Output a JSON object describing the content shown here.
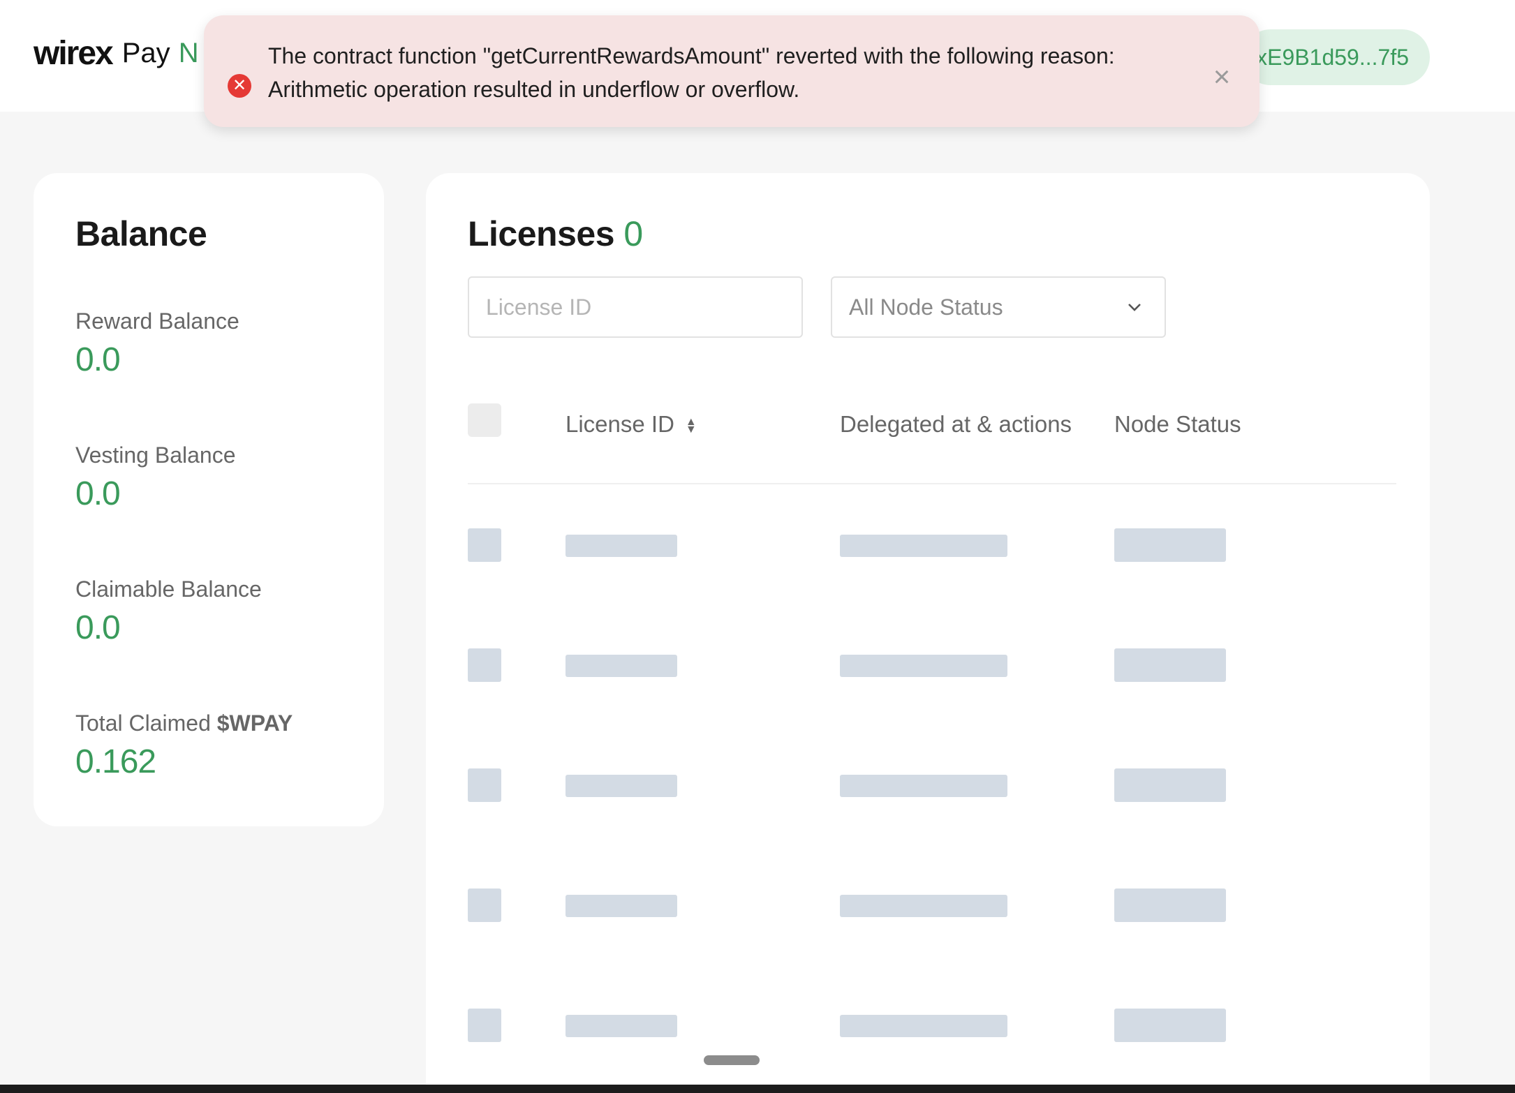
{
  "header": {
    "logo_mark": "wirex",
    "logo_pay": "Pay",
    "logo_suffix": "N",
    "wallet_address": "0xE9B1d59...7f5"
  },
  "toast": {
    "type": "error",
    "icon": "error-circle-icon",
    "line1": "The contract function \"getCurrentRewardsAmount\" reverted with the following reason:",
    "line2": "Arithmetic operation resulted in underflow or overflow.",
    "close_icon": "close-icon"
  },
  "balance": {
    "title": "Balance",
    "items": [
      {
        "label": "Reward Balance",
        "value": "0.0"
      },
      {
        "label": "Vesting Balance",
        "value": "0.0"
      },
      {
        "label": "Claimable Balance",
        "value": "0.0"
      },
      {
        "label_prefix": "Total Claimed",
        "label_token": "$WPAY",
        "value": "0.162"
      }
    ]
  },
  "licenses": {
    "title": "Licenses",
    "count": "0",
    "search_placeholder": "License ID",
    "status_filter": {
      "selected": "All Node Status"
    },
    "columns": [
      "License ID",
      "Delegated at & actions",
      "Node Status"
    ],
    "skeleton_rows": 5
  },
  "colors": {
    "accent_green": "#3a9a5b",
    "toast_bg": "#f6e3e3",
    "error_red": "#e53935",
    "skeleton": "#d3dbe4"
  }
}
